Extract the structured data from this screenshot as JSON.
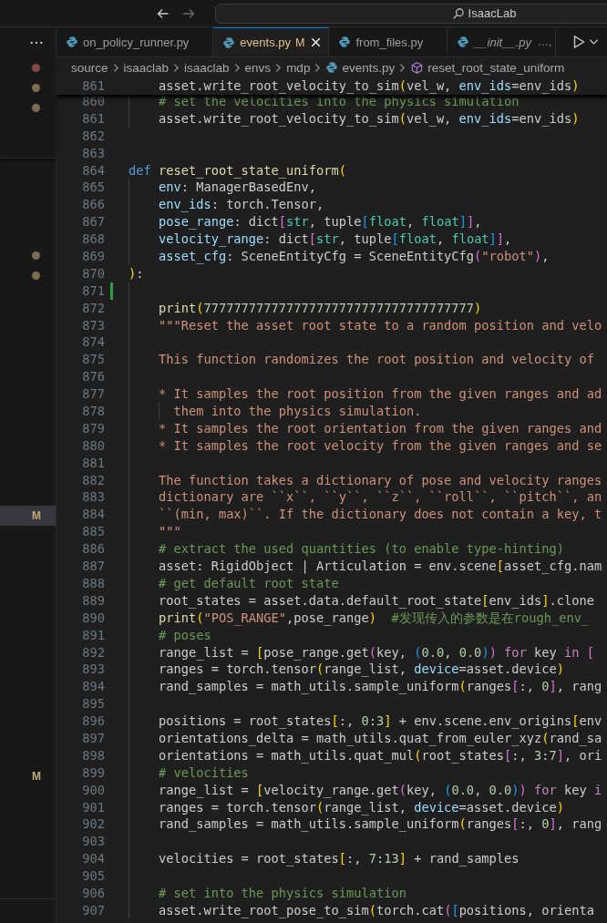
{
  "navigation": {
    "back": {
      "disabled": false
    },
    "forward": {
      "disabled": true
    }
  },
  "command_center": {
    "label": "IsaacLab"
  },
  "tabs": [
    {
      "label": "on_policy_runner.py",
      "selected": false,
      "modified": false,
      "preview": false
    },
    {
      "label": "events.py",
      "badge": "M",
      "selected": true,
      "modified": true,
      "preview": false
    },
    {
      "label": "from_files.py",
      "selected": false,
      "modified": false,
      "preview": false
    },
    {
      "label": "__init__.py",
      "description": "…,",
      "selected": false,
      "modified": false,
      "preview": true
    }
  ],
  "breadcrumb": [
    {
      "label": "source",
      "kind": "folder"
    },
    {
      "label": "isaaclab",
      "kind": "folder"
    },
    {
      "label": "isaaclab",
      "kind": "folder"
    },
    {
      "label": "envs",
      "kind": "folder"
    },
    {
      "label": "mdp",
      "kind": "folder"
    },
    {
      "label": "events.py",
      "kind": "file"
    },
    {
      "label": "reset_root_state_uniform",
      "kind": "symbol"
    }
  ],
  "sidebar": {
    "sections": [
      {
        "items": [
          {
            "kind": "dot",
            "color": "#8a4848",
            "selected": false
          },
          {
            "kind": "dot",
            "color": "#7b6d54",
            "selected": false
          },
          {
            "kind": "dot",
            "color": "#7b6d54",
            "selected": false
          },
          {
            "kind": "blank",
            "selected": false
          },
          {
            "kind": "blank",
            "selected": false
          }
        ]
      },
      {
        "items": [
          {
            "kind": "blank",
            "selected": false
          },
          {
            "kind": "blank",
            "selected": false
          },
          {
            "kind": "blank",
            "selected": false
          },
          {
            "kind": "blank",
            "selected": false
          },
          {
            "kind": "dot",
            "color": "#7b6d54",
            "selected": false
          },
          {
            "kind": "dot",
            "color": "#7b6d54",
            "selected": false
          },
          {
            "kind": "blank",
            "selected": false
          },
          {
            "kind": "blank",
            "selected": false
          },
          {
            "kind": "blank",
            "selected": false
          },
          {
            "kind": "blank",
            "selected": false
          },
          {
            "kind": "blank",
            "selected": false
          },
          {
            "kind": "blank",
            "selected": false
          },
          {
            "kind": "blank",
            "selected": false
          },
          {
            "kind": "blank",
            "selected": false
          },
          {
            "kind": "blank",
            "selected": false
          },
          {
            "kind": "blank",
            "selected": false
          },
          {
            "kind": "blank",
            "selected": false
          },
          {
            "kind": "badge",
            "badge": "M",
            "selected": true
          },
          {
            "kind": "blank",
            "selected": false
          },
          {
            "kind": "blank",
            "selected": false
          },
          {
            "kind": "blank",
            "selected": false
          },
          {
            "kind": "blank",
            "selected": false
          },
          {
            "kind": "blank",
            "selected": false
          },
          {
            "kind": "blank",
            "selected": false
          },
          {
            "kind": "blank",
            "selected": false
          },
          {
            "kind": "blank",
            "selected": false
          },
          {
            "kind": "blank",
            "selected": false
          },
          {
            "kind": "blank",
            "selected": false
          },
          {
            "kind": "blank",
            "selected": false
          },
          {
            "kind": "blank",
            "selected": false
          },
          {
            "kind": "badge",
            "badge": "M",
            "selected": false
          },
          {
            "kind": "blank",
            "selected": false
          },
          {
            "kind": "blank",
            "selected": false
          },
          {
            "kind": "blank",
            "selected": false
          },
          {
            "kind": "blank",
            "selected": false
          }
        ]
      }
    ]
  },
  "editor": {
    "sticky": {
      "number": "861",
      "tokens": [
        {
          "text": "    asset.write_root_velocity_to_sim",
          "kind": "plain"
        },
        {
          "text": "(",
          "kind": "b1"
        },
        {
          "text": "vel_w, ",
          "kind": "plain"
        },
        {
          "text": "env_ids",
          "kind": "param"
        },
        {
          "text": "=env_ids",
          "kind": "plain"
        },
        {
          "text": ")",
          "kind": "b1"
        }
      ]
    },
    "lines": [
      {
        "number": "860",
        "modified": false,
        "tokens": [
          {
            "text": "    # set the velocities into the physics simulation",
            "kind": "comment"
          }
        ]
      },
      {
        "number": "861",
        "modified": false,
        "tokens": [
          {
            "text": "    asset.write_root_velocity_to_sim",
            "kind": "plain"
          },
          {
            "text": "(",
            "kind": "b1"
          },
          {
            "text": "vel_w, ",
            "kind": "plain"
          },
          {
            "text": "env_ids",
            "kind": "param"
          },
          {
            "text": "=env_ids",
            "kind": "plain"
          },
          {
            "text": ")",
            "kind": "b1"
          }
        ]
      },
      {
        "number": "862",
        "modified": false
      },
      {
        "number": "863",
        "modified": false
      },
      {
        "number": "864",
        "modified": false,
        "tokens": [
          {
            "text": "def",
            "kind": "kw"
          },
          {
            "text": " reset_root_state_uniform",
            "kind": "fn"
          },
          {
            "text": "(",
            "kind": "b1"
          }
        ]
      },
      {
        "number": "865",
        "modified": false,
        "tokens": [
          {
            "text": "    env",
            "kind": "param"
          },
          {
            "text": ": ManagerBasedEnv,",
            "kind": "plain"
          }
        ]
      },
      {
        "number": "866",
        "modified": false,
        "tokens": [
          {
            "text": "    env_ids",
            "kind": "param"
          },
          {
            "text": ": torch.Tensor,",
            "kind": "plain"
          }
        ]
      },
      {
        "number": "867",
        "modified": false,
        "tokens": [
          {
            "text": "    pose_range",
            "kind": "param"
          },
          {
            "text": ": dict",
            "kind": "plain"
          },
          {
            "text": "[",
            "kind": "b2"
          },
          {
            "text": "str",
            "kind": "type"
          },
          {
            "text": ", tuple",
            "kind": "plain"
          },
          {
            "text": "[",
            "kind": "b3"
          },
          {
            "text": "float",
            "kind": "type"
          },
          {
            "text": ", ",
            "kind": "plain"
          },
          {
            "text": "float",
            "kind": "type"
          },
          {
            "text": "]",
            "kind": "b3"
          },
          {
            "text": "]",
            "kind": "b2"
          },
          {
            "text": ",",
            "kind": "plain"
          }
        ]
      },
      {
        "number": "868",
        "modified": false,
        "tokens": [
          {
            "text": "    velocity_range",
            "kind": "param"
          },
          {
            "text": ": dict",
            "kind": "plain"
          },
          {
            "text": "[",
            "kind": "b2"
          },
          {
            "text": "str",
            "kind": "type"
          },
          {
            "text": ", tuple",
            "kind": "plain"
          },
          {
            "text": "[",
            "kind": "b3"
          },
          {
            "text": "float",
            "kind": "type"
          },
          {
            "text": ", ",
            "kind": "plain"
          },
          {
            "text": "float",
            "kind": "type"
          },
          {
            "text": "]",
            "kind": "b3"
          },
          {
            "text": "]",
            "kind": "b2"
          },
          {
            "text": ",",
            "kind": "plain"
          }
        ]
      },
      {
        "number": "869",
        "modified": false,
        "tokens": [
          {
            "text": "    asset_cfg",
            "kind": "param"
          },
          {
            "text": ": SceneEntityCfg = SceneEntityCfg",
            "kind": "plain"
          },
          {
            "text": "(",
            "kind": "b2"
          },
          {
            "text": "\"robot\"",
            "kind": "str"
          },
          {
            "text": ")",
            "kind": "b2"
          },
          {
            "text": ",",
            "kind": "plain"
          }
        ]
      },
      {
        "number": "870",
        "modified": false,
        "tokens": [
          {
            "text": ")",
            "kind": "b1"
          },
          {
            "text": ":",
            "kind": "plain"
          }
        ]
      },
      {
        "number": "871",
        "modified": true
      },
      {
        "number": "872",
        "modified": false,
        "tokens": [
          {
            "text": "    print",
            "kind": "fn"
          },
          {
            "text": "(",
            "kind": "b1"
          },
          {
            "text": "777777777777777777777777777777777777",
            "kind": "num"
          },
          {
            "text": ")",
            "kind": "b1"
          }
        ]
      },
      {
        "number": "873",
        "modified": false,
        "tokens": [
          {
            "text": "    \"\"\"Reset the asset root state to a random position and velo",
            "kind": "str"
          }
        ]
      },
      {
        "number": "874",
        "modified": false
      },
      {
        "number": "875",
        "modified": false,
        "tokens": [
          {
            "text": "    This function randomizes the root position and velocity of",
            "kind": "str"
          }
        ]
      },
      {
        "number": "876",
        "modified": false
      },
      {
        "number": "877",
        "modified": false,
        "tokens": [
          {
            "text": "    * It samples the root position from the given ranges and ad",
            "kind": "str"
          }
        ]
      },
      {
        "number": "878",
        "modified": false,
        "tokens": [
          {
            "text": "      them into the physics simulation.",
            "kind": "str"
          }
        ]
      },
      {
        "number": "879",
        "modified": false,
        "tokens": [
          {
            "text": "    * It samples the root orientation from the given ranges and",
            "kind": "str"
          }
        ]
      },
      {
        "number": "880",
        "modified": false,
        "tokens": [
          {
            "text": "    * It samples the root velocity from the given ranges and se",
            "kind": "str"
          }
        ]
      },
      {
        "number": "881",
        "modified": false
      },
      {
        "number": "882",
        "modified": false,
        "tokens": [
          {
            "text": "    The function takes a dictionary of pose and velocity ranges",
            "kind": "str"
          }
        ]
      },
      {
        "number": "883",
        "modified": false,
        "tokens": [
          {
            "text": "    dictionary are ``x``, ``y``, ``z``, ``roll``, ``pitch``, an",
            "kind": "str"
          }
        ]
      },
      {
        "number": "884",
        "modified": false,
        "tokens": [
          {
            "text": "    ``(min, max)``. If the dictionary does not contain a key, t",
            "kind": "str"
          }
        ]
      },
      {
        "number": "885",
        "modified": false,
        "tokens": [
          {
            "text": "    \"\"\"",
            "kind": "str"
          }
        ]
      },
      {
        "number": "886",
        "modified": false,
        "tokens": [
          {
            "text": "    # extract the used quantities (to enable type-hinting)",
            "kind": "comment"
          }
        ]
      },
      {
        "number": "887",
        "modified": false,
        "tokens": [
          {
            "text": "    asset: RigidObject | Articulation = env.scene",
            "kind": "plain"
          },
          {
            "text": "[",
            "kind": "b1"
          },
          {
            "text": "asset_cfg.nam",
            "kind": "plain"
          }
        ]
      },
      {
        "number": "888",
        "modified": false,
        "tokens": [
          {
            "text": "    # get default root state",
            "kind": "comment"
          }
        ]
      },
      {
        "number": "889",
        "modified": false,
        "tokens": [
          {
            "text": "    root_states = asset.data.default_root_state",
            "kind": "plain"
          },
          {
            "text": "[",
            "kind": "b1"
          },
          {
            "text": "env_ids",
            "kind": "plain"
          },
          {
            "text": "]",
            "kind": "b1"
          },
          {
            "text": ".clone",
            "kind": "plain"
          }
        ]
      },
      {
        "number": "890",
        "modified": false,
        "tokens": [
          {
            "text": "    print",
            "kind": "fn"
          },
          {
            "text": "(",
            "kind": "b1"
          },
          {
            "text": "\"POS_RANGE\"",
            "kind": "str"
          },
          {
            "text": ",pose_range",
            "kind": "plain"
          },
          {
            "text": ")",
            "kind": "b1"
          },
          {
            "text": "  #发现传入的参数是在rough_env_",
            "kind": "comment"
          }
        ]
      },
      {
        "number": "891",
        "modified": false,
        "tokens": [
          {
            "text": "    # poses",
            "kind": "comment"
          }
        ]
      },
      {
        "number": "892",
        "modified": false,
        "tokens": [
          {
            "text": "    range_list = ",
            "kind": "plain"
          },
          {
            "text": "[",
            "kind": "b1"
          },
          {
            "text": "pose_range.get",
            "kind": "plain"
          },
          {
            "text": "(",
            "kind": "b2"
          },
          {
            "text": "key, ",
            "kind": "plain"
          },
          {
            "text": "(",
            "kind": "b3"
          },
          {
            "text": "0.0",
            "kind": "num"
          },
          {
            "text": ", ",
            "kind": "plain"
          },
          {
            "text": "0.0",
            "kind": "num"
          },
          {
            "text": ")",
            "kind": "b3"
          },
          {
            "text": ")",
            "kind": "b2"
          },
          {
            "text": " for",
            "kind": "ctrl"
          },
          {
            "text": " key ",
            "kind": "plain"
          },
          {
            "text": "in",
            "kind": "ctrl"
          },
          {
            "text": " [",
            "kind": "b2"
          }
        ]
      },
      {
        "number": "893",
        "modified": false,
        "tokens": [
          {
            "text": "    ranges = torch.tensor",
            "kind": "plain"
          },
          {
            "text": "(",
            "kind": "b1"
          },
          {
            "text": "range_list, ",
            "kind": "plain"
          },
          {
            "text": "device",
            "kind": "param"
          },
          {
            "text": "=asset.device",
            "kind": "plain"
          },
          {
            "text": ")",
            "kind": "b1"
          }
        ]
      },
      {
        "number": "894",
        "modified": false,
        "tokens": [
          {
            "text": "    rand_samples = math_utils.sample_uniform",
            "kind": "plain"
          },
          {
            "text": "(",
            "kind": "b1"
          },
          {
            "text": "ranges",
            "kind": "plain"
          },
          {
            "text": "[",
            "kind": "b2"
          },
          {
            "text": ":, ",
            "kind": "plain"
          },
          {
            "text": "0",
            "kind": "num"
          },
          {
            "text": "]",
            "kind": "b2"
          },
          {
            "text": ", rang",
            "kind": "plain"
          }
        ]
      },
      {
        "number": "895",
        "modified": false
      },
      {
        "number": "896",
        "modified": false,
        "tokens": [
          {
            "text": "    positions = root_states",
            "kind": "plain"
          },
          {
            "text": "[",
            "kind": "b1"
          },
          {
            "text": ":, ",
            "kind": "plain"
          },
          {
            "text": "0",
            "kind": "num"
          },
          {
            "text": ":",
            "kind": "plain"
          },
          {
            "text": "3",
            "kind": "num"
          },
          {
            "text": "]",
            "kind": "b1"
          },
          {
            "text": " + env.scene.env_origins",
            "kind": "plain"
          },
          {
            "text": "[",
            "kind": "b1"
          },
          {
            "text": "env",
            "kind": "plain"
          }
        ]
      },
      {
        "number": "897",
        "modified": false,
        "tokens": [
          {
            "text": "    orientations_delta = math_utils.quat_from_euler_xyz",
            "kind": "plain"
          },
          {
            "text": "(",
            "kind": "b1"
          },
          {
            "text": "rand_sa",
            "kind": "plain"
          }
        ]
      },
      {
        "number": "898",
        "modified": false,
        "tokens": [
          {
            "text": "    orientations = math_utils.quat_mul",
            "kind": "plain"
          },
          {
            "text": "(",
            "kind": "b1"
          },
          {
            "text": "root_states",
            "kind": "plain"
          },
          {
            "text": "[",
            "kind": "b2"
          },
          {
            "text": ":, ",
            "kind": "plain"
          },
          {
            "text": "3",
            "kind": "num"
          },
          {
            "text": ":",
            "kind": "plain"
          },
          {
            "text": "7",
            "kind": "num"
          },
          {
            "text": "]",
            "kind": "b2"
          },
          {
            "text": ", ori",
            "kind": "plain"
          }
        ]
      },
      {
        "number": "899",
        "modified": false,
        "tokens": [
          {
            "text": "    # velocities",
            "kind": "comment"
          }
        ]
      },
      {
        "number": "900",
        "modified": false,
        "tokens": [
          {
            "text": "    range_list = ",
            "kind": "plain"
          },
          {
            "text": "[",
            "kind": "b1"
          },
          {
            "text": "velocity_range.get",
            "kind": "plain"
          },
          {
            "text": "(",
            "kind": "b2"
          },
          {
            "text": "key, ",
            "kind": "plain"
          },
          {
            "text": "(",
            "kind": "b3"
          },
          {
            "text": "0.0",
            "kind": "num"
          },
          {
            "text": ", ",
            "kind": "plain"
          },
          {
            "text": "0.0",
            "kind": "num"
          },
          {
            "text": ")",
            "kind": "b3"
          },
          {
            "text": ")",
            "kind": "b2"
          },
          {
            "text": " for",
            "kind": "ctrl"
          },
          {
            "text": " key ",
            "kind": "plain"
          },
          {
            "text": "i",
            "kind": "ctrl"
          }
        ]
      },
      {
        "number": "901",
        "modified": false,
        "tokens": [
          {
            "text": "    ranges = torch.tensor",
            "kind": "plain"
          },
          {
            "text": "(",
            "kind": "b1"
          },
          {
            "text": "range_list, ",
            "kind": "plain"
          },
          {
            "text": "device",
            "kind": "param"
          },
          {
            "text": "=asset.device",
            "kind": "plain"
          },
          {
            "text": ")",
            "kind": "b1"
          }
        ]
      },
      {
        "number": "902",
        "modified": false,
        "tokens": [
          {
            "text": "    rand_samples = math_utils.sample_uniform",
            "kind": "plain"
          },
          {
            "text": "(",
            "kind": "b1"
          },
          {
            "text": "ranges",
            "kind": "plain"
          },
          {
            "text": "[",
            "kind": "b2"
          },
          {
            "text": ":, ",
            "kind": "plain"
          },
          {
            "text": "0",
            "kind": "num"
          },
          {
            "text": "]",
            "kind": "b2"
          },
          {
            "text": ", rang",
            "kind": "plain"
          }
        ]
      },
      {
        "number": "903",
        "modified": false
      },
      {
        "number": "904",
        "modified": false,
        "tokens": [
          {
            "text": "    velocities = root_states",
            "kind": "plain"
          },
          {
            "text": "[",
            "kind": "b1"
          },
          {
            "text": ":, ",
            "kind": "plain"
          },
          {
            "text": "7",
            "kind": "num"
          },
          {
            "text": ":",
            "kind": "plain"
          },
          {
            "text": "13",
            "kind": "num"
          },
          {
            "text": "]",
            "kind": "b1"
          },
          {
            "text": " + rand_samples",
            "kind": "plain"
          }
        ]
      },
      {
        "number": "905",
        "modified": false
      },
      {
        "number": "906",
        "modified": false,
        "tokens": [
          {
            "text": "    # set into the physics simulation",
            "kind": "comment"
          }
        ]
      },
      {
        "number": "907",
        "modified": false,
        "tokens": [
          {
            "text": "    asset.write_root_pose_to_sim",
            "kind": "plain"
          },
          {
            "text": "(",
            "kind": "b1"
          },
          {
            "text": "torch.cat",
            "kind": "plain"
          },
          {
            "text": "(",
            "kind": "b2"
          },
          {
            "text": "[",
            "kind": "b3"
          },
          {
            "text": "positions, orienta",
            "kind": "plain"
          }
        ]
      }
    ]
  }
}
